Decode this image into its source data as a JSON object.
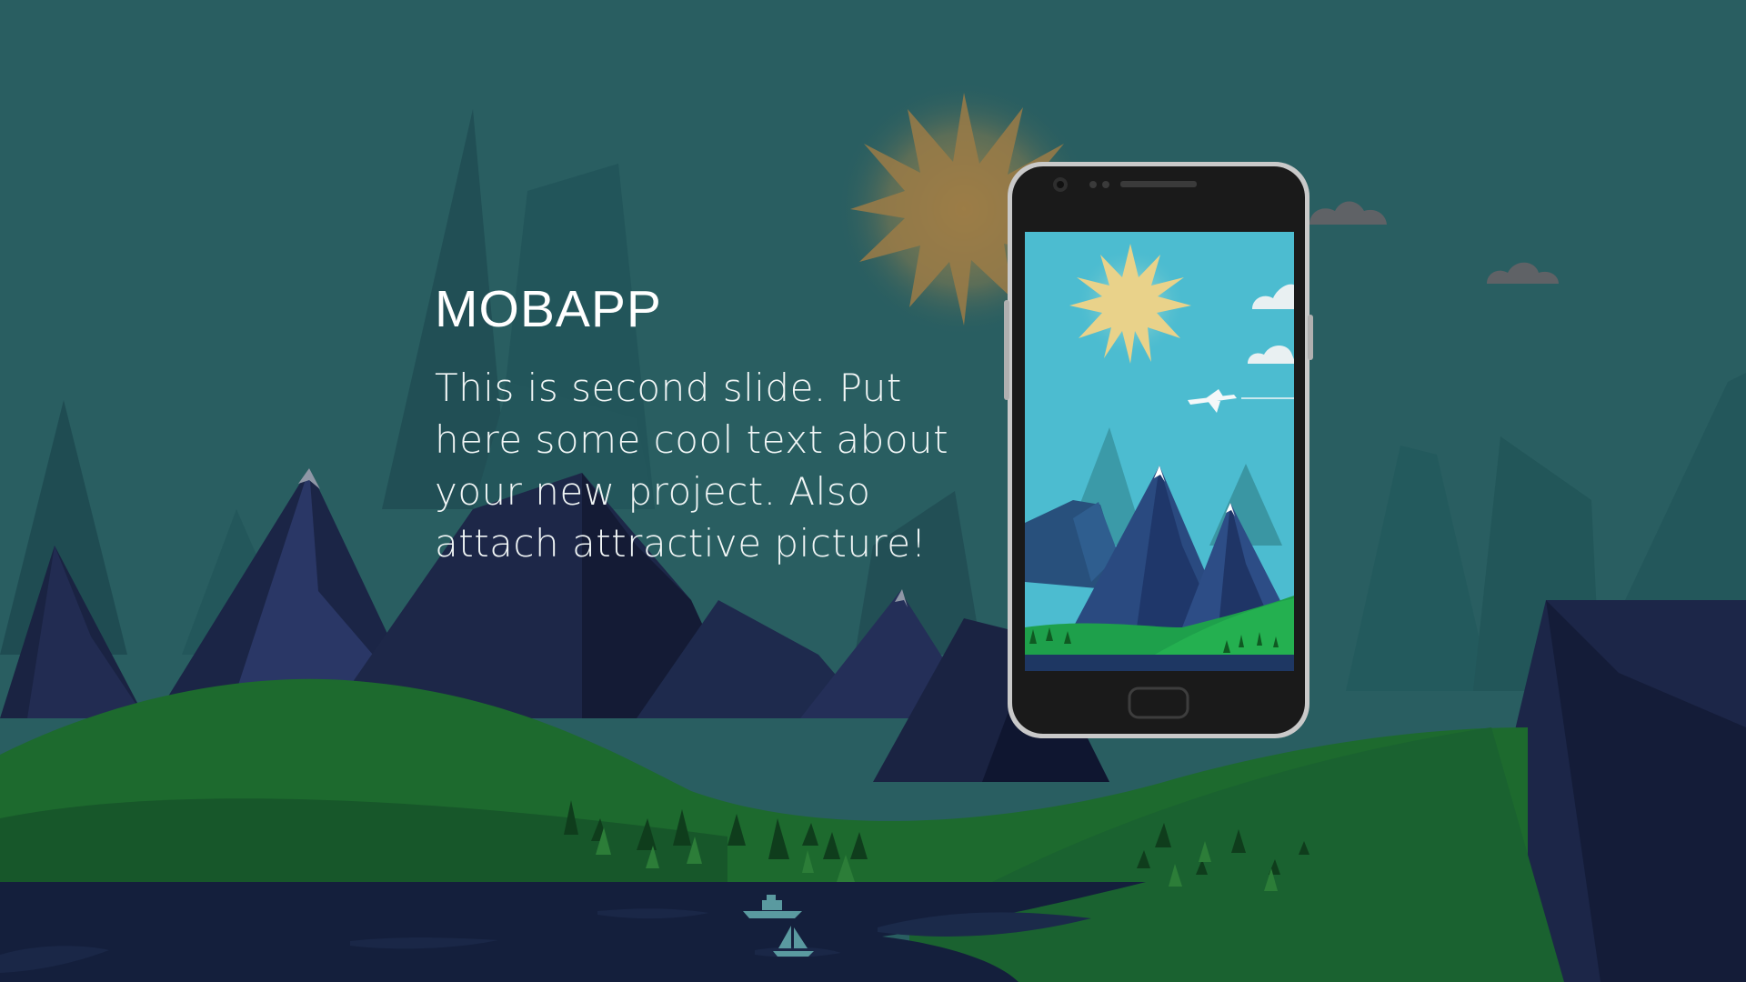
{
  "slide": {
    "title": "MOBAPP",
    "body_lines": [
      "This is second slide. Put",
      "here some cool text about",
      "your new project. Also",
      "attach attractive picture!"
    ]
  },
  "colors": {
    "sky": "#295e61",
    "far_mountains": "#1f4f55",
    "mid_mountains": "#2b6466",
    "mountains_dark": "#1c2645",
    "hill_green": "#1d6a2e",
    "lake": "#141f3c",
    "sun": "#a07a3c",
    "phone_frame": "#1a1a1a",
    "phone_bezel": "#c8c8c8",
    "screen_sky": "#4cbcd0"
  },
  "icons": {
    "sun": "sun-icon",
    "cloud": "cloud-icon",
    "airplane": "airplane-icon",
    "boat": "boat-icon",
    "tree": "tree-icon"
  }
}
